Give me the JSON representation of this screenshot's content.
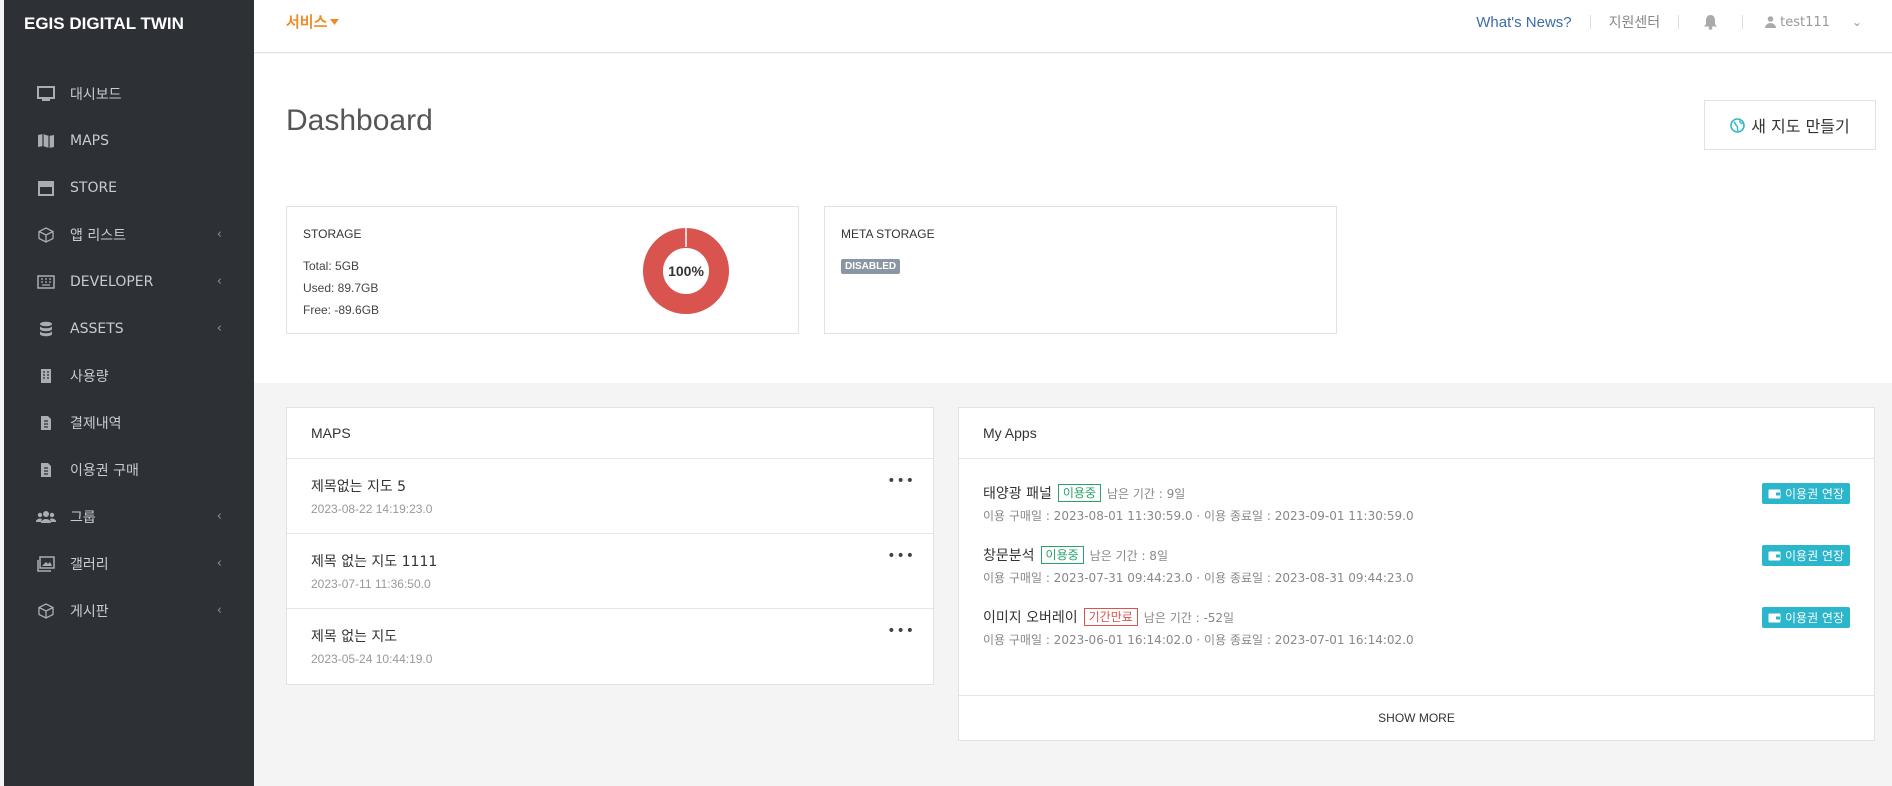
{
  "sidebar": {
    "brand": "EGIS DIGITAL TWIN",
    "items": [
      {
        "label": "대시보드",
        "icon": "monitor-icon"
      },
      {
        "label": "MAPS",
        "icon": "map-icon"
      },
      {
        "label": "STORE",
        "icon": "store-icon"
      },
      {
        "label": "앱 리스트",
        "icon": "cube-icon",
        "expandable": true
      },
      {
        "label": "DEVELOPER",
        "icon": "keyboard-icon",
        "expandable": true
      },
      {
        "label": "ASSETS",
        "icon": "database-icon",
        "expandable": true
      },
      {
        "label": "사용량",
        "icon": "building-icon"
      },
      {
        "label": "결제내역",
        "icon": "invoice-icon"
      },
      {
        "label": "이용권 구매",
        "icon": "invoice-icon"
      },
      {
        "label": "그룹",
        "icon": "users-icon",
        "expandable": true
      },
      {
        "label": "갤러리",
        "icon": "images-icon",
        "expandable": true
      },
      {
        "label": "게시판",
        "icon": "cube-icon",
        "expandable": true
      }
    ]
  },
  "topbar": {
    "service_label": "서비스",
    "news_label": "What's News?",
    "support_label": "지원센터",
    "username": "test111"
  },
  "page": {
    "title": "Dashboard",
    "new_map_label": "새 지도 만들기"
  },
  "storage": {
    "title": "STORAGE",
    "total": "Total: 5GB",
    "used": "Used: 89.7GB",
    "free": "Free: -89.6GB",
    "percent_label": "100%",
    "percent": 100
  },
  "meta_storage": {
    "title": "META STORAGE",
    "status": "DISABLED"
  },
  "maps_panel": {
    "title": "MAPS",
    "items": [
      {
        "name": "제목없는 지도 5",
        "date": "2023-08-22 14:19:23.0"
      },
      {
        "name": "제목 없는 지도 1111",
        "date": "2023-07-11 11:36:50.0"
      },
      {
        "name": "제목 없는 지도",
        "date": "2023-05-24 10:44:19.0"
      }
    ]
  },
  "apps_panel": {
    "title": "My Apps",
    "extend_label": "이용권 연장",
    "show_more": "SHOW MORE",
    "items": [
      {
        "name": "태양광 패널",
        "status": "이용중",
        "remain": "남은 기간 : 9일",
        "purchase": "이용 구매일 : 2023-08-01 11:30:59.0",
        "end": "이용 종료일 : 2023-09-01 11:30:59.0"
      },
      {
        "name": "창문분석",
        "status": "이용중",
        "remain": "남은 기간 : 8일",
        "purchase": "이용 구매일 : 2023-07-31 09:44:23.0",
        "end": "이용 종료일 : 2023-08-31 09:44:23.0"
      },
      {
        "name": "이미지 오버레이",
        "status": "기간만료",
        "remain": "남은 기간 : -52일",
        "purchase": "이용 구매일 : 2023-06-01 16:14:02.0",
        "end": "이용 종료일 : 2023-07-01 16:14:02.0"
      }
    ]
  },
  "colors": {
    "sidebar_bg": "#2d3035",
    "accent_orange": "#f08a24",
    "donut_red": "#d9534f",
    "extend_teal": "#2cb6cc",
    "status_green": "#29a36a"
  }
}
